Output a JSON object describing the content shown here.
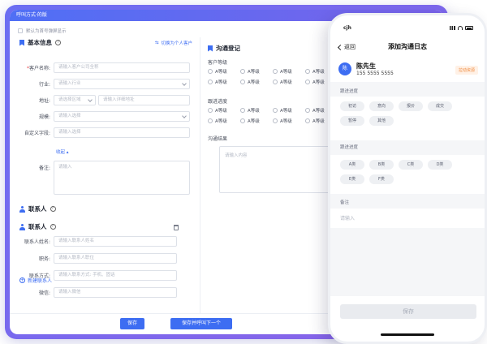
{
  "window": {
    "title": "呼叫方式·的版",
    "top_checkbox_label": "默认为首号弹屏显示"
  },
  "basic": {
    "title": "基本信息",
    "switch_link": "切换为个人客户",
    "fields": [
      {
        "label": "客户名称:",
        "required": true,
        "placeholder": "请输入客户公司全称"
      },
      {
        "label": "行业:",
        "placeholder": "请输入行业"
      },
      {
        "label": "地址:",
        "placeholder": "请选择区域",
        "placeholder2": "请输入详细地址"
      },
      {
        "label": "规模:",
        "placeholder": "请输入选择"
      },
      {
        "label": "自定义字段:",
        "placeholder": "请输入选择"
      }
    ],
    "collapse": "收起 ▴",
    "remark_label": "备注:",
    "remark_placeholder": "请输入"
  },
  "contacts": {
    "section_title": "联系人",
    "item_title": "联系人",
    "fields": [
      {
        "label": "联系人姓名:",
        "placeholder": "请输入联系人姓名"
      },
      {
        "label": "职务:",
        "placeholder": "请输入联系人职位"
      },
      {
        "label": "联系方式:",
        "placeholder": "请输入联系方式: 手机、固话"
      },
      {
        "label": "微信:",
        "placeholder": "请输入微信"
      }
    ],
    "add_label": "新建联系人"
  },
  "comm": {
    "title": "沟通登记",
    "level_label": "客户等级",
    "level_options": [
      "A等级",
      "A等级",
      "A等级",
      "A等级",
      "A等级",
      "A等级",
      "A等级",
      "A等级"
    ],
    "progress_label": "跟进进度",
    "progress_options": [
      "A等级",
      "A等级",
      "A等级",
      "A等级",
      "A等级",
      "A等级",
      "A等级",
      "A等级"
    ],
    "result_label": "沟通结果",
    "result_placeholder": "请输入内容"
  },
  "footer": {
    "save": "保存",
    "save_next": "保存并呼叫下一个"
  },
  "phone": {
    "status_time": "cjh",
    "back": "返回",
    "title": "添加沟通日志",
    "contact": {
      "avatar": "陈",
      "name": "陈先生",
      "phone": "155 5555 5555",
      "badge": "拉动资源"
    },
    "progress_label": "跟进进度",
    "progress_chips": [
      "初访",
      "意向",
      "报价",
      "成交",
      "暂停",
      "其他"
    ],
    "level_label": "跟进进度",
    "level_chips": [
      "A类",
      "B类",
      "C类",
      "D类",
      "E类",
      "F类"
    ],
    "remark_label": "备注",
    "remark_placeholder": "请输入",
    "save": "保存"
  }
}
